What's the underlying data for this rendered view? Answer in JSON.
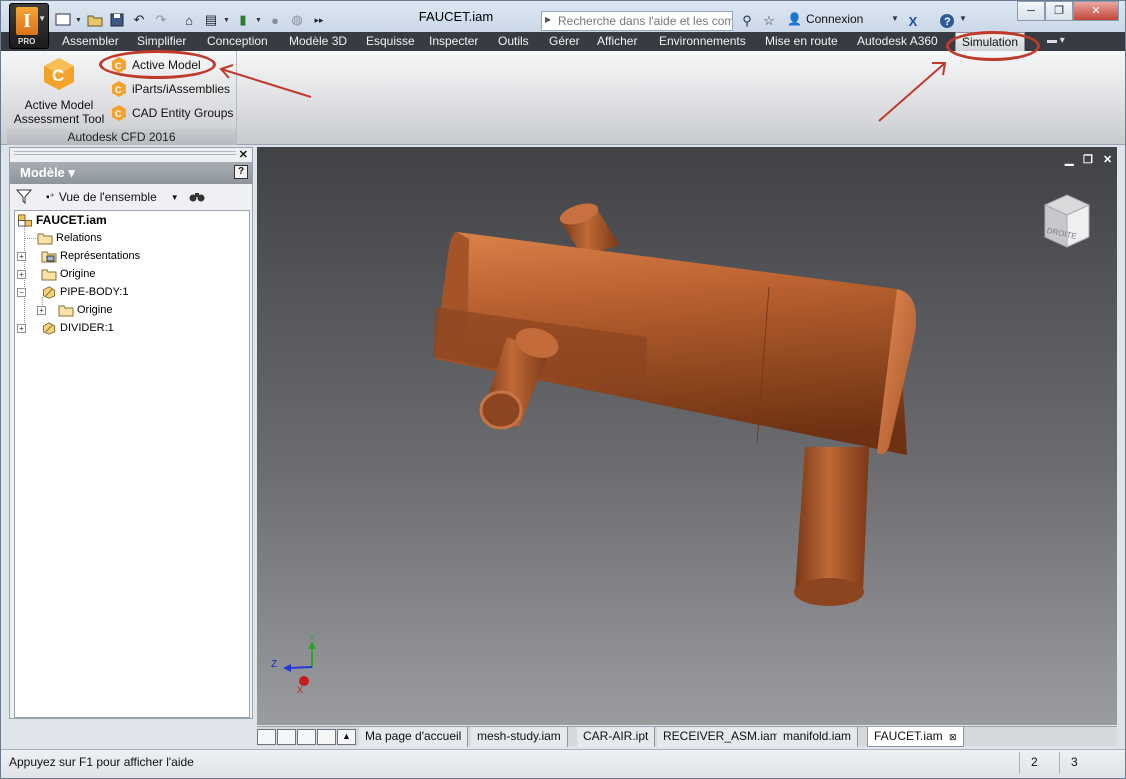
{
  "window": {
    "doc_title": "FAUCET.iam",
    "controls": [
      "─",
      "❐",
      "✕"
    ]
  },
  "app_menu": {
    "edition": "PRO"
  },
  "search": {
    "placeholder": "Recherche dans l'aide et les com"
  },
  "account": {
    "label": "Connexion"
  },
  "ribbon_tabs": [
    "Assembler",
    "Simplifier",
    "Conception",
    "Modèle 3D",
    "Esquisse",
    "Inspecter",
    "Outils",
    "Gérer",
    "Afficher",
    "Environnements",
    "Mise en route",
    "Autodesk A360",
    "Simulation"
  ],
  "active_tab": "Simulation",
  "ribbon_panel": {
    "title": "Autodesk CFD 2016",
    "big_button": {
      "line1": "Active Model",
      "line2": "Assessment Tool"
    },
    "small_buttons": [
      "Active Model",
      "iParts/iAssemblies",
      "CAD Entity Groups"
    ]
  },
  "browser": {
    "title": "Modèle",
    "view_label": "Vue de l'ensemble",
    "tree": [
      {
        "label": "FAUCET.iam"
      },
      {
        "label": "Relations"
      },
      {
        "label": "Représentations"
      },
      {
        "label": "Origine"
      },
      {
        "label": "PIPE-BODY:1"
      },
      {
        "label": "Origine"
      },
      {
        "label": "DIVIDER:1"
      }
    ]
  },
  "viewport": {
    "viewcube_face": "DROITE",
    "triad": {
      "y": "Y",
      "z": "Z",
      "x": "X"
    },
    "part_color": "#b8602f"
  },
  "doc_tabs": [
    "Ma page d'accueil",
    "mesh-study.iam",
    "CAR-AIR.ipt",
    "RECEIVER_ASM.iam",
    "manifold.iam",
    "FAUCET.iam"
  ],
  "active_doc_tab": "FAUCET.iam",
  "statusbar": {
    "message": "Appuyez sur F1 pour afficher l'aide",
    "count_a": "2",
    "count_b": "3"
  },
  "annotation_color": "#c0392b"
}
